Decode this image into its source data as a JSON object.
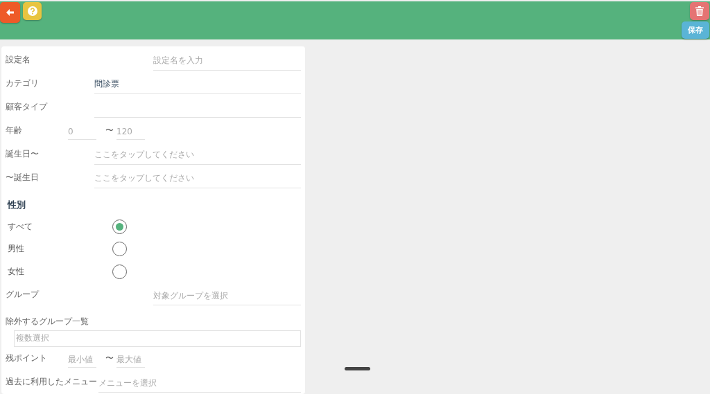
{
  "header": {
    "buttons": [
      {
        "kind": "back"
      },
      {
        "kind": "help"
      },
      {
        "kind": "delete"
      }
    ],
    "save_button": "保存"
  },
  "form": [
    {
      "kind": "text",
      "label": "設定名",
      "placeholder": "設定名を入力"
    },
    {
      "kind": "select",
      "label": "カテゴリ",
      "value": "問診票"
    },
    {
      "kind": "select",
      "label": "顧客タイプ"
    },
    {
      "kind": "range",
      "label": "年齢",
      "min_placeholder": "0",
      "separator": "〜",
      "max_placeholder": "120"
    },
    {
      "kind": "select",
      "label": "誕生日〜",
      "placeholder": "ここをタップしてください"
    },
    {
      "kind": "select",
      "label": "〜誕生日",
      "placeholder": "ここをタップしてください"
    },
    {
      "kind": "heading",
      "label": "性別"
    },
    {
      "kind": "radio",
      "label": "すべて",
      "selected": true
    },
    {
      "kind": "radio",
      "label": "男性",
      "selected": false
    },
    {
      "kind": "radio",
      "label": "女性",
      "selected": false
    },
    {
      "kind": "text",
      "label": "グループ",
      "placeholder": "対象グループを選択"
    },
    {
      "kind": "multiselect",
      "label": "除外するグループ一覧",
      "placeholder": "複数選択"
    },
    {
      "kind": "range",
      "label": "残ポイント",
      "min_placeholder": "最小値",
      "separator": "〜",
      "max_placeholder": "最大値"
    },
    {
      "kind": "select",
      "label": "過去に利用したメニュー",
      "placeholder": "メニューを選択"
    }
  ]
}
